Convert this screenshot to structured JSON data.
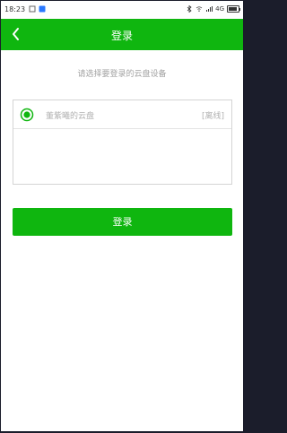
{
  "status_bar": {
    "time": "18:23",
    "network": "4G"
  },
  "app_bar": {
    "title": "登录",
    "back_icon": "chevron-left-icon"
  },
  "main": {
    "prompt": "请选择要登录的云盘设备",
    "devices": [
      {
        "name": "董紫曦的云盘",
        "status": "[离线]",
        "selected": true
      }
    ],
    "login_button_label": "登录"
  },
  "colors": {
    "accent": "#0fb60f",
    "muted_text": "#b0b0b0"
  }
}
